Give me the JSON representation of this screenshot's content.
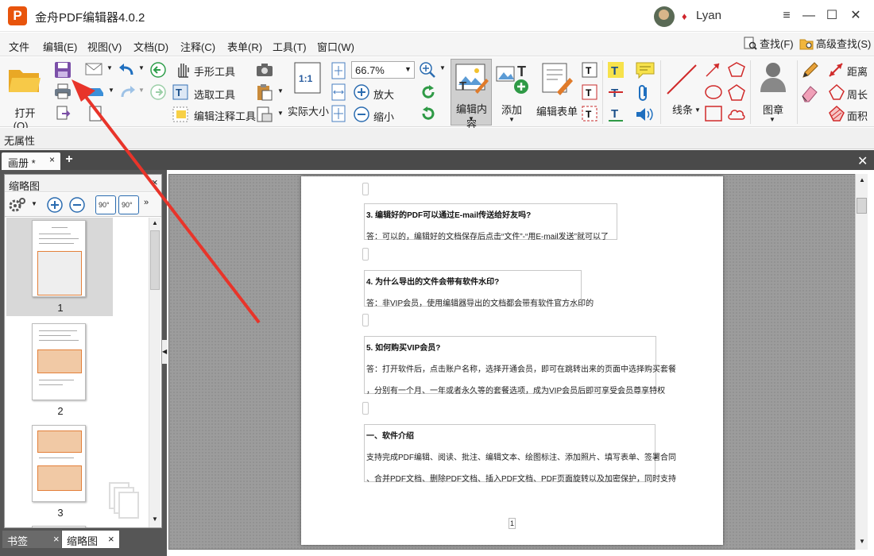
{
  "title_bar": {
    "app_logo": "P",
    "app_title": "金舟PDF编辑器4.0.2",
    "username": "Lyan",
    "window_controls": {
      "menu": "≡",
      "minimize": "—",
      "maximize": "☐",
      "close": "✕"
    }
  },
  "menu_bar": {
    "items": [
      "文件",
      "编辑(E)",
      "视图(V)",
      "文档(D)",
      "注释(C)",
      "表单(R)",
      "工具(T)",
      "窗口(W)"
    ],
    "find_label": "查找(F)",
    "advanced_find_label": "高级查找(S)"
  },
  "toolbar": {
    "open_label": "打开(O)...",
    "hand_tool_label": "手形工具",
    "select_text_label": "选取工具",
    "edit_annotation_label": "编辑注释工具",
    "actual_size_label": "实际大小",
    "actual_size_icon_text": "1:1",
    "zoom_value": "66.7%",
    "zoom_in_label": "放大",
    "zoom_out_label": "缩小",
    "edit_content_label": "编辑内容",
    "add_label": "添加",
    "edit_form_label": "编辑表单",
    "line_label": "线条",
    "stamp_label": "图章",
    "distance_label": "距离",
    "perimeter_label": "周长",
    "area_label": "面积"
  },
  "property_bar": {
    "text": "无属性"
  },
  "doc_tabs": {
    "active_tab": "画册 *",
    "close": "×",
    "add": "+"
  },
  "thumbnail_panel": {
    "title": "缩略图",
    "close": "×",
    "rotate_left": "90°",
    "rotate_right": "90°",
    "pages": [
      "1",
      "2",
      "3"
    ]
  },
  "bottom_tabs": {
    "bookmarks": "书签",
    "thumbnails": "缩略图"
  },
  "document": {
    "qa": [
      {
        "q": "3. 编辑好的PDF可以通过E-mail传送给好友吗?",
        "a": [
          "答：可以的，编辑好的文档保存后点击“文件”-“用E-mail发送”就可以了"
        ]
      },
      {
        "q": "4. 为什么导出的文件会带有软件水印?",
        "a": [
          "答：非VIP会员，使用编辑器导出的文档都会带有软件官方水印的"
        ]
      },
      {
        "q": "5. 如何购买VIP会员?",
        "a": [
          "答：打开软件后，点击账户名称，选择开通会员，即可在跳转出来的页面中选择购买套餐",
          "，分别有一个月、一年或者永久等的套餐选项，成为VIP会员后即可享受会员尊享特权"
        ]
      },
      {
        "q": "一、软件介绍",
        "a": [
          "支持完成PDF编辑、阅读、批注、编辑文本、绘图标注、添加照片、填写表单、签署合同",
          "、合并PDF文档、删除PDF文档、插入PDF文档、PDF页面旋转以及加密保护，同时支持"
        ]
      }
    ],
    "page_number": "1"
  },
  "colors": {
    "annotation_arrow": "#e8342a",
    "brand": "#e8540c",
    "edit_content_active": "#cfcfcf"
  }
}
